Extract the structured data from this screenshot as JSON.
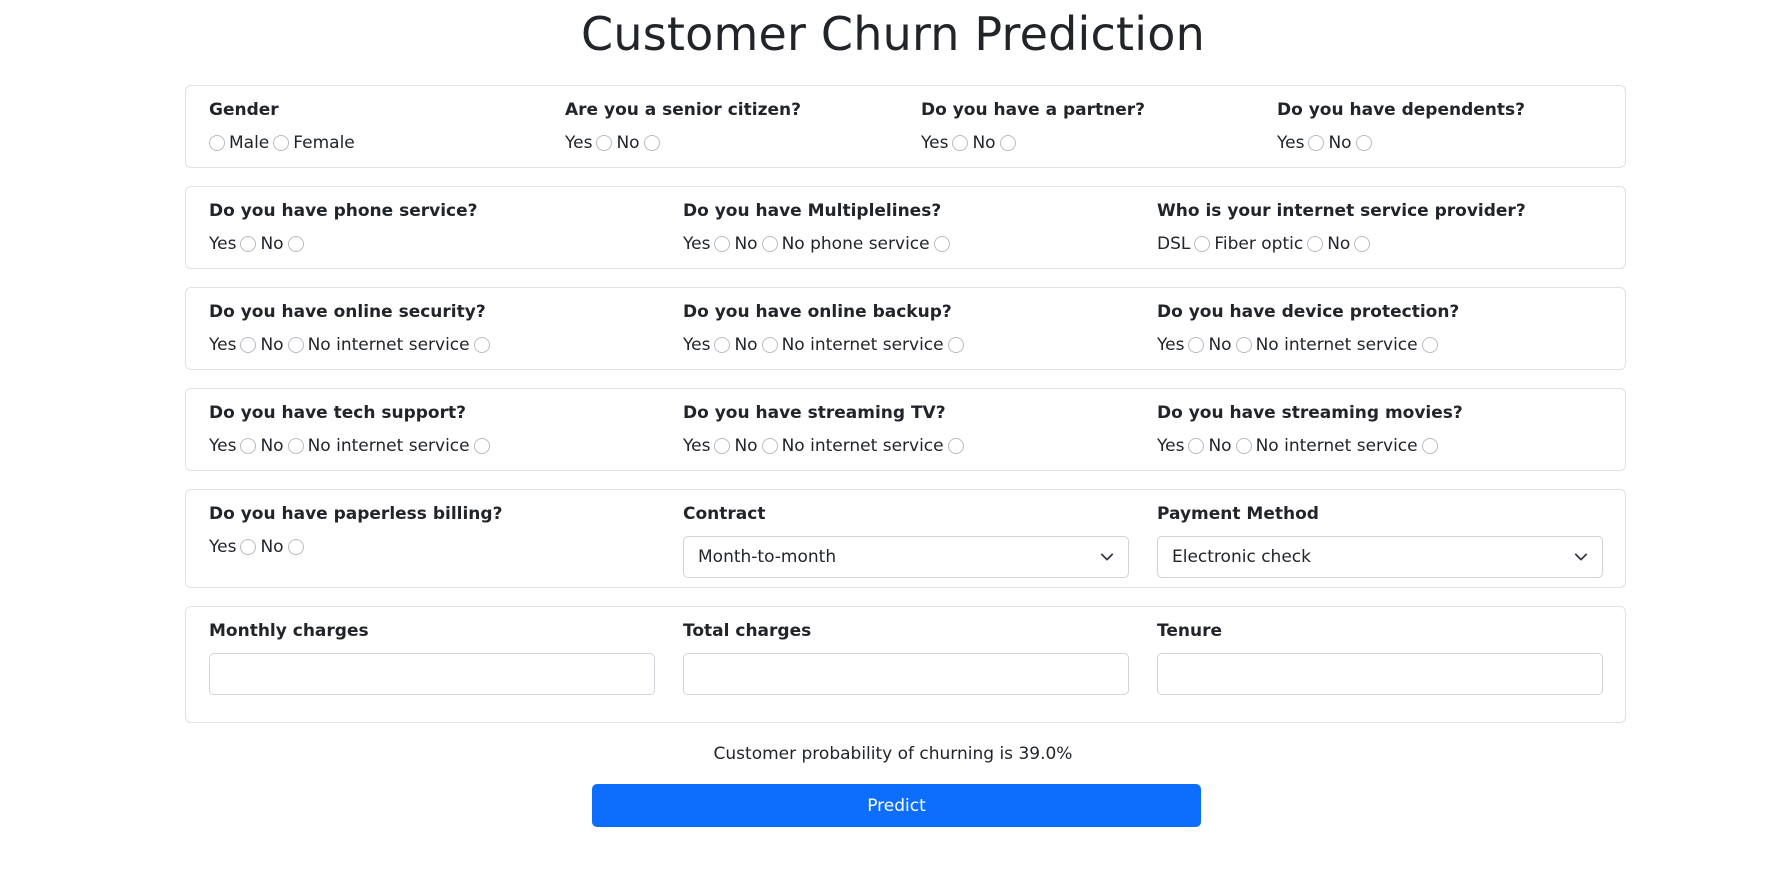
{
  "page": {
    "title": "Customer Churn Prediction"
  },
  "row1": {
    "gender": {
      "label": "Gender",
      "options": [
        "Male",
        "Female"
      ]
    },
    "senior": {
      "label": "Are you a senior citizen?",
      "options": [
        "Yes",
        "No"
      ]
    },
    "partner": {
      "label": "Do you have a partner?",
      "options": [
        "Yes",
        "No"
      ]
    },
    "dependents": {
      "label": "Do you have dependents?",
      "options": [
        "Yes",
        "No"
      ]
    }
  },
  "row2": {
    "phone": {
      "label": "Do you have phone service?",
      "options": [
        "Yes",
        "No"
      ]
    },
    "multiplelines": {
      "label": "Do you have Multiplelines?",
      "options": [
        "Yes",
        "No",
        "No phone service"
      ]
    },
    "internet": {
      "label": "Who is your internet service provider?",
      "options": [
        "DSL",
        "Fiber optic",
        "No"
      ]
    }
  },
  "row3": {
    "security": {
      "label": "Do you have online security?",
      "options": [
        "Yes",
        "No",
        "No internet service"
      ]
    },
    "backup": {
      "label": "Do you have online backup?",
      "options": [
        "Yes",
        "No",
        "No internet service"
      ]
    },
    "protection": {
      "label": "Do you have device protection?",
      "options": [
        "Yes",
        "No",
        "No internet service"
      ]
    }
  },
  "row4": {
    "techsupport": {
      "label": "Do you have tech support?",
      "options": [
        "Yes",
        "No",
        "No internet service"
      ]
    },
    "streamingtv": {
      "label": "Do you have streaming TV?",
      "options": [
        "Yes",
        "No",
        "No internet service"
      ]
    },
    "streamingmovies": {
      "label": "Do you have streaming movies?",
      "options": [
        "Yes",
        "No",
        "No internet service"
      ]
    }
  },
  "row5": {
    "paperless": {
      "label": "Do you have paperless billing?",
      "options": [
        "Yes",
        "No"
      ]
    },
    "contract": {
      "label": "Contract",
      "selected": "Month-to-month"
    },
    "payment": {
      "label": "Payment Method",
      "selected": "Electronic check"
    }
  },
  "row6": {
    "monthly": {
      "label": "Monthly charges",
      "value": ""
    },
    "total": {
      "label": "Total charges",
      "value": ""
    },
    "tenure": {
      "label": "Tenure",
      "value": ""
    }
  },
  "result": {
    "text": "Customer probability of churning is 39.0%"
  },
  "actions": {
    "predict_label": "Predict"
  },
  "icons": {
    "select_chevron": "chevron-down-icon"
  },
  "colors": {
    "primary": "#0d6efd",
    "border": "#dee2e6"
  }
}
